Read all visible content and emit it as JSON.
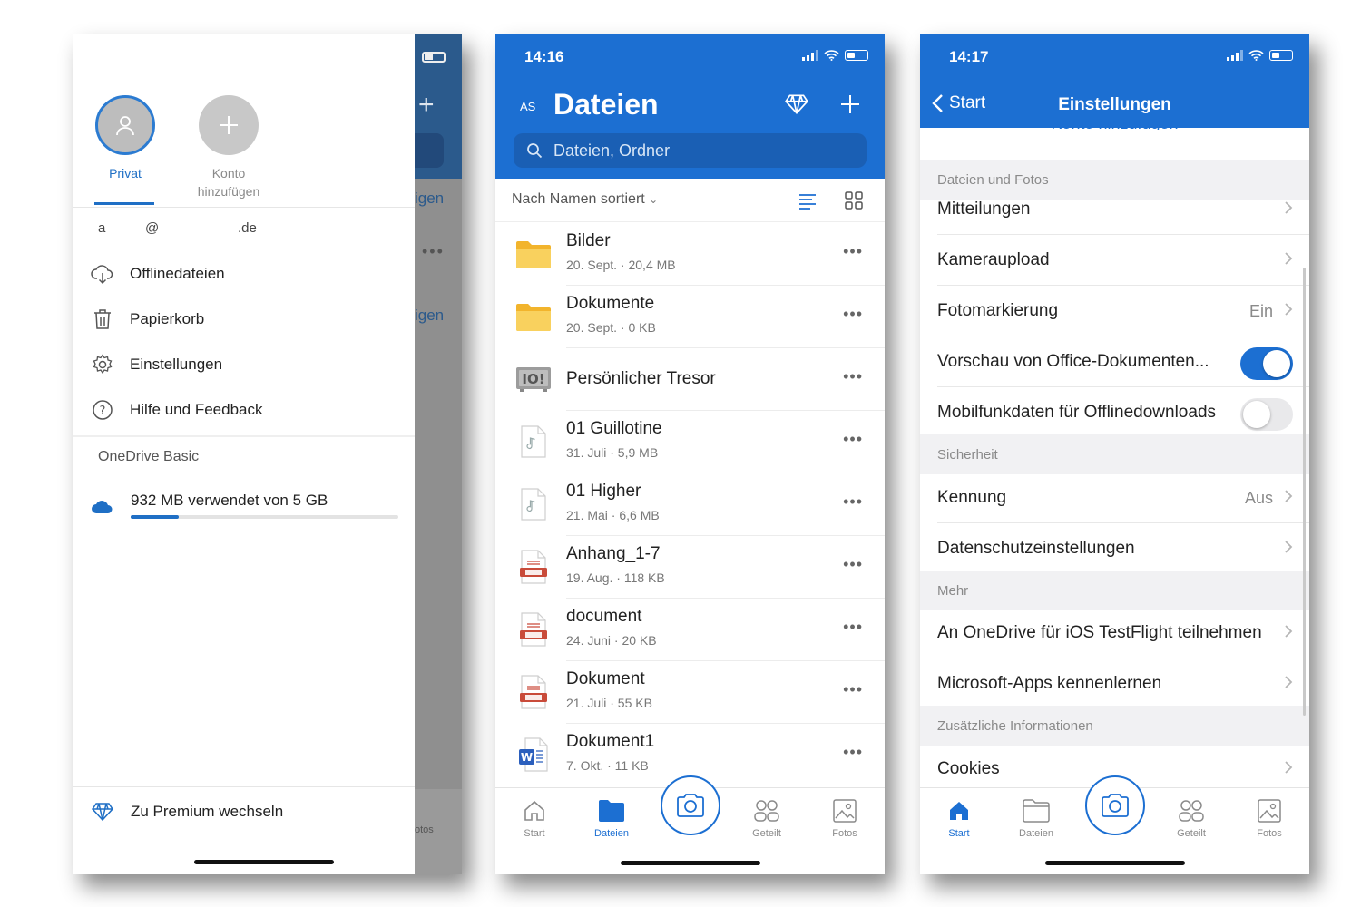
{
  "phone1": {
    "accounts": [
      {
        "label": "Privat"
      },
      {
        "label": "Konto\nhinzufügen"
      }
    ],
    "email": {
      "user": "a",
      "at": "@",
      "domain": ".de"
    },
    "menu": [
      {
        "label": "Offlinedateien",
        "icon": "cloud-download-icon"
      },
      {
        "label": "Papierkorb",
        "icon": "trash-icon"
      },
      {
        "label": "Einstellungen",
        "icon": "gear-icon"
      },
      {
        "label": "Hilfe und Feedback",
        "icon": "help-icon"
      }
    ],
    "plan_label": "OneDrive Basic",
    "storage_text": "932 MB verwendet von 5 GB",
    "storage_used_fraction": 0.18,
    "premium_label": "Zu Premium wechseln",
    "behind": {
      "t1": "igen",
      "t2": "igen",
      "fotos": "otos"
    }
  },
  "phone2": {
    "time": "14:16",
    "initials": "AS",
    "title": "Dateien",
    "search_placeholder": "Dateien, Ordner",
    "sort_label": "Nach Namen sortiert",
    "files": [
      {
        "name": "Bilder",
        "meta": "20. Sept. · 20,4 MB",
        "type": "folder"
      },
      {
        "name": "Dokumente",
        "meta": "20. Sept. · 0 KB",
        "type": "folder"
      },
      {
        "name": "Persönlicher Tresor",
        "meta": "",
        "type": "vault"
      },
      {
        "name": "01 Guillotine",
        "meta": "31. Juli · 5,9 MB",
        "type": "audio"
      },
      {
        "name": "01 Higher",
        "meta": "21. Mai · 6,6 MB",
        "type": "audio"
      },
      {
        "name": "Anhang_1-7",
        "meta": "19. Aug. · 118 KB",
        "type": "pdf"
      },
      {
        "name": "document",
        "meta": "24. Juni · 20 KB",
        "type": "pdf"
      },
      {
        "name": "Dokument",
        "meta": "21. Juli · 55 KB",
        "type": "pdf"
      },
      {
        "name": "Dokument1",
        "meta": "7. Okt. · 11 KB",
        "type": "word"
      }
    ],
    "tabs": [
      {
        "label": "Start",
        "icon": "home-icon"
      },
      {
        "label": "Dateien",
        "icon": "folder-icon"
      },
      {
        "label": "Geteilt",
        "icon": "shared-icon"
      },
      {
        "label": "Fotos",
        "icon": "photos-icon"
      }
    ],
    "active_tab": "Dateien"
  },
  "phone3": {
    "time": "14:17",
    "back_label": "Start",
    "title": "Einstellungen",
    "ghost_text": "Konto hinzufügen",
    "sections": [
      {
        "header": "Dateien und Fotos",
        "rows": [
          {
            "label": "Mitteilungen",
            "kind": "chevron"
          },
          {
            "label": "Kameraupload",
            "kind": "chevron"
          },
          {
            "label": "Fotomarkierung",
            "value": "Ein",
            "kind": "chevron"
          },
          {
            "label": "Vorschau von Office-Dokumenten...",
            "kind": "toggle",
            "on": true
          },
          {
            "label": "Mobilfunkdaten für Offlinedownloads",
            "kind": "toggle",
            "on": false
          }
        ]
      },
      {
        "header": "Sicherheit",
        "rows": [
          {
            "label": "Kennung",
            "value": "Aus",
            "kind": "chevron"
          },
          {
            "label": "Datenschutzeinstellungen",
            "kind": "chevron"
          }
        ]
      },
      {
        "header": "Mehr",
        "rows": [
          {
            "label": "An OneDrive für iOS TestFlight teilnehmen",
            "kind": "chevron"
          },
          {
            "label": "Microsoft-Apps kennenlernen",
            "kind": "chevron"
          }
        ]
      },
      {
        "header": "Zusätzliche Informationen",
        "rows": [
          {
            "label": "Cookies",
            "kind": "chevron"
          }
        ]
      }
    ],
    "tabs": [
      {
        "label": "Start",
        "icon": "home-icon"
      },
      {
        "label": "Dateien",
        "icon": "folder-icon"
      },
      {
        "label": "Geteilt",
        "icon": "shared-icon"
      },
      {
        "label": "Fotos",
        "icon": "photos-icon"
      }
    ],
    "active_tab": "Start"
  },
  "colors": {
    "accent": "#1c6fd2",
    "folder": "#f7c948",
    "pdf": "#c94b3a",
    "word": "#2b5fbd"
  }
}
